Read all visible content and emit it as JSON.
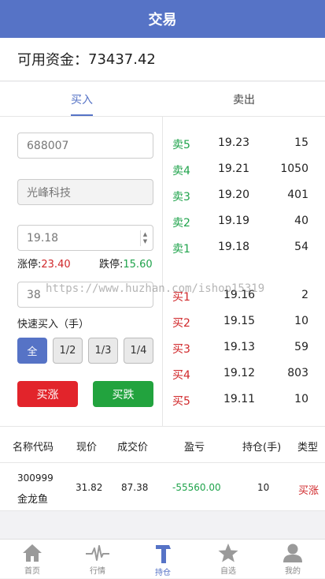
{
  "header": {
    "title": "交易"
  },
  "funds": {
    "label": "可用资金：",
    "value": "73437.42"
  },
  "tabs": [
    {
      "label": "买入",
      "active": true
    },
    {
      "label": "卖出",
      "active": false
    }
  ],
  "order_form": {
    "code": "688007",
    "name": "光峰科技",
    "price": "19.18",
    "limit_up_label": "涨停:",
    "limit_up_value": "23.40",
    "limit_down_label": "跌停:",
    "limit_down_value": "15.60",
    "quantity": "38",
    "quick_buy_label": "快速买入（手）",
    "quick_buttons": [
      "全",
      "1/2",
      "1/3",
      "1/4"
    ],
    "buy_rise_label": "买涨",
    "buy_fall_label": "买跌"
  },
  "order_book": {
    "asks": [
      {
        "label": "卖5",
        "price": "19.23",
        "volume": "15"
      },
      {
        "label": "卖4",
        "price": "19.21",
        "volume": "1050"
      },
      {
        "label": "卖3",
        "price": "19.20",
        "volume": "401"
      },
      {
        "label": "卖2",
        "price": "19.19",
        "volume": "40"
      },
      {
        "label": "卖1",
        "price": "19.18",
        "volume": "54"
      }
    ],
    "bids": [
      {
        "label": "买1",
        "price": "19.16",
        "volume": "2"
      },
      {
        "label": "买2",
        "price": "19.15",
        "volume": "10"
      },
      {
        "label": "买3",
        "price": "19.13",
        "volume": "59"
      },
      {
        "label": "买4",
        "price": "19.12",
        "volume": "803"
      },
      {
        "label": "买5",
        "price": "19.11",
        "volume": "10"
      }
    ]
  },
  "watermark": "https://www.huzhan.com/ishop15319",
  "positions": {
    "headers": [
      "名称代码",
      "现价",
      "成交价",
      "盈亏",
      "持仓(手)",
      "类型"
    ],
    "rows": [
      {
        "code": "300999",
        "name": "金龙鱼",
        "price": "31.82",
        "deal_price": "87.38",
        "pnl": "-55560.00",
        "qty": "10",
        "type": "买涨"
      }
    ]
  },
  "nav": [
    {
      "label": "首页",
      "icon": "home-icon",
      "active": false
    },
    {
      "label": "行情",
      "icon": "pulse-icon",
      "active": false
    },
    {
      "label": "持仓",
      "icon": "hammer-icon",
      "active": true
    },
    {
      "label": "自选",
      "icon": "star-icon",
      "active": false
    },
    {
      "label": "我的",
      "icon": "user-icon",
      "active": false
    }
  ],
  "colors": {
    "primary": "#5673c6",
    "rise": "#e2242b",
    "fall": "#22a33e",
    "ask_label": "#1fa34b",
    "bid_label": "#d0272a"
  }
}
